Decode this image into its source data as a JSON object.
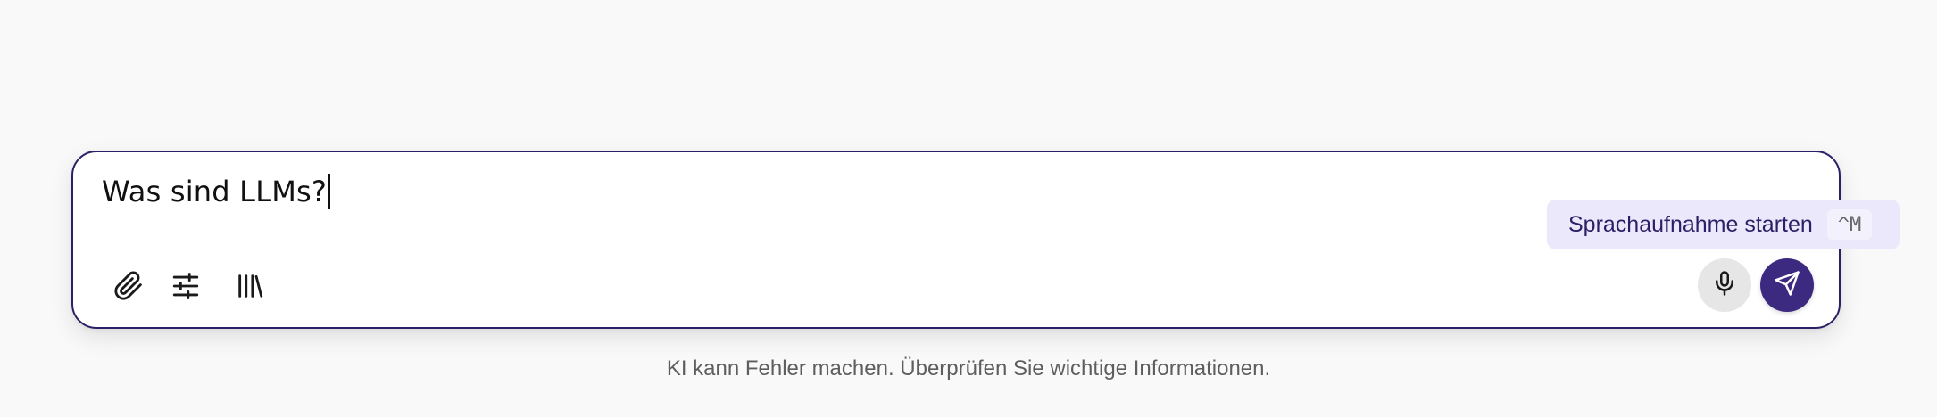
{
  "composer": {
    "input_value": "Was sind LLMs?",
    "tools": [
      {
        "name": "paperclip-icon"
      },
      {
        "name": "sliders-icon"
      },
      {
        "name": "library-icon"
      }
    ]
  },
  "tooltip": {
    "label": "Sprachaufnahme starten",
    "shortcut": "^M"
  },
  "actions": {
    "mic_icon": "microphone-icon",
    "send_icon": "send-icon"
  },
  "footer": {
    "disclaimer": "KI kann Fehler machen. Überprüfen Sie wichtige Informationen."
  },
  "colors": {
    "accent": "#3c2a80",
    "border": "#2d1f66",
    "tooltip_bg": "#ebe8fb"
  }
}
